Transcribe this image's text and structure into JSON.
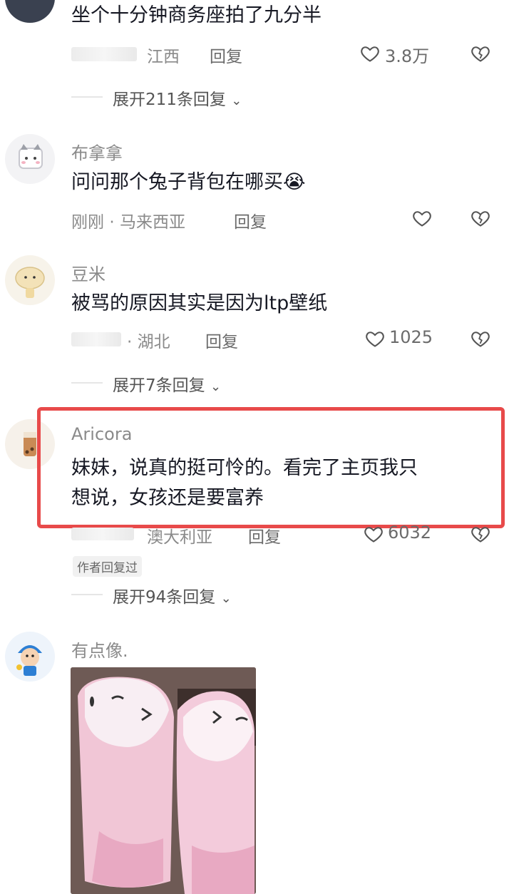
{
  "comments": [
    {
      "text": "坐个十分钟商务座拍了九分半",
      "location": "江西",
      "reply_label": "回复",
      "likes": "3.8万",
      "expand_label": "展开211条回复"
    },
    {
      "username": "布拿拿",
      "text": "问问那个兔子背包在哪买😭",
      "time": "刚刚",
      "location": "马来西亚",
      "reply_label": "回复",
      "likes": ""
    },
    {
      "username": "豆米",
      "text": "被骂的原因其实是因为ltp壁纸",
      "location": "湖北",
      "reply_label": "回复",
      "likes": "1025",
      "expand_label": "展开7条回复"
    },
    {
      "username": "Aricora",
      "text_line1": "妹妹，说真的挺可怜的。看完了主页我只",
      "text_line2": "想说，女孩还是要富养",
      "location": "澳大利亚",
      "reply_label": "回复",
      "likes": "6032",
      "badge": "作者回复过",
      "expand_label": "展开94条回复"
    },
    {
      "username": "有点像."
    }
  ],
  "colors": {
    "highlight": "#e84a4a",
    "text": "#161823",
    "secondary": "#8a8a8a"
  }
}
